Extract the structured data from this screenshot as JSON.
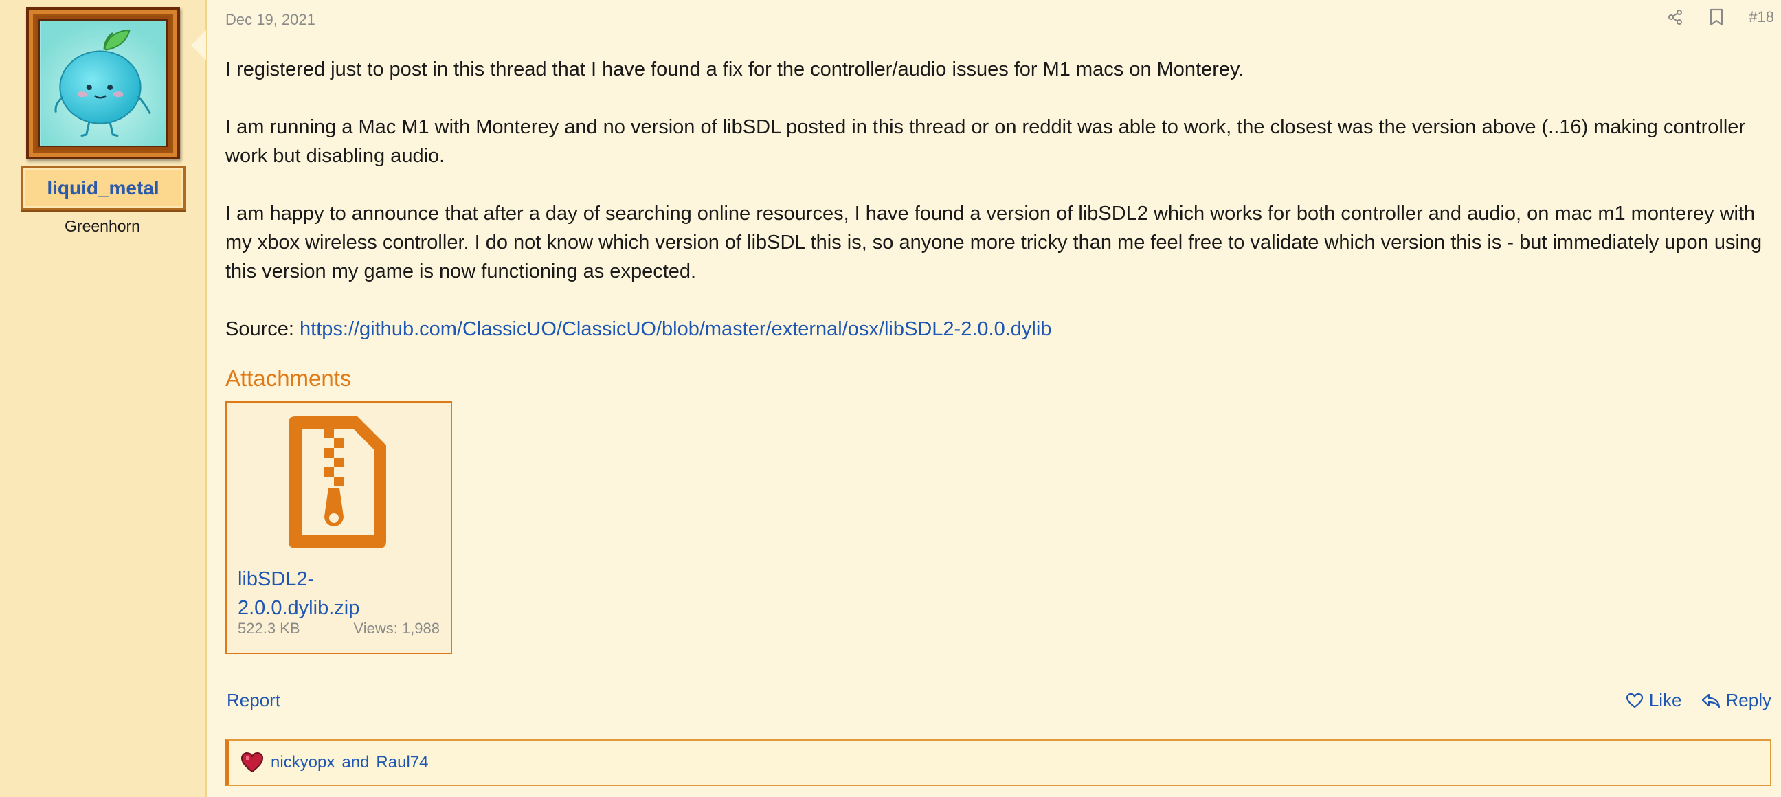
{
  "user": {
    "username": "liquid_metal",
    "title": "Greenhorn"
  },
  "post": {
    "date": "Dec 19, 2021",
    "number": "#18",
    "paragraphs": [
      "I registered just to post in this thread that I have found a fix for the controller/audio issues for M1 macs on Monterey.",
      "I am running a Mac M1 with Monterey and no version of libSDL posted in this thread or on reddit was able to work, the closest was the version above (..16) making controller work but disabling audio.",
      "I am happy to announce that after a day of searching online resources, I have found a version of libSDL2 which works for both controller and audio, on mac m1 monterey with my xbox wireless controller. I do not know which version of libSDL this is, so anyone more tricky than me feel free to validate which version this is - but immediately upon using this version my game is now functioning as expected."
    ],
    "source_label": "Source:",
    "source_url": "https://github.com/ClassicUO/ClassicUO/blob/master/external/osx/libSDL2-2.0.0.dylib"
  },
  "attachments": {
    "heading": "Attachments",
    "file": {
      "name": "libSDL2-2.0.0.dylib.zip",
      "name_line1": "libSDL2-",
      "name_line2": "2.0.0.dylib.zip",
      "size": "522.3 KB",
      "views": "Views: 1,988",
      "icon": "zip-file-icon"
    }
  },
  "actions": {
    "report": "Report",
    "like": "Like",
    "reply": "Reply"
  },
  "reactions": {
    "user1": "nickyopx",
    "joiner": "and",
    "user2": "Raul74",
    "icon": "heart-icon"
  },
  "colors": {
    "link": "#1d57b3",
    "accent": "#e07a16",
    "background": "#fef6dc",
    "sidebar": "#fbe8b8"
  }
}
